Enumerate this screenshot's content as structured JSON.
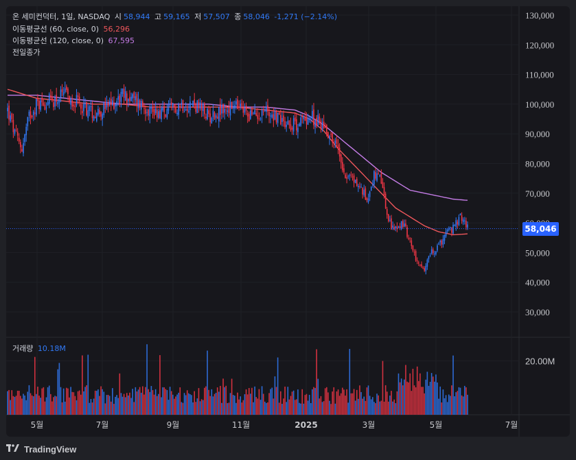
{
  "header": {
    "title": "온 세미컨덕터, 1일, NASDAQ",
    "open_label": "시",
    "open": "58,944",
    "high_label": "고",
    "high": "59,165",
    "low_label": "저",
    "low": "57,507",
    "close_label": "종",
    "close": "58,046",
    "change": "-1,271 (−2.14%)"
  },
  "indicators": {
    "ma60_label": "이동평균선 (60, close, 0)",
    "ma60_value": "56,296",
    "ma120_label": "이동평균선 (120, close, 0)",
    "ma120_value": "67,595",
    "prev_close_label": "전일종가"
  },
  "volume": {
    "label": "거래량",
    "value": "10.18M"
  },
  "price_badge": "58,046",
  "footer": {
    "brand": "TradingView"
  },
  "colors": {
    "up": "#3179f5",
    "down": "#f23645",
    "ma60": "#f0575c",
    "ma120": "#c47ce6",
    "badge": "#2962ff"
  },
  "chart_data": {
    "type": "candlestick",
    "y_axis": {
      "ticks": [
        "130,000",
        "120,000",
        "110,000",
        "100,000",
        "90,000",
        "80,000",
        "70,000",
        "60,000",
        "50,000",
        "40,000",
        "30,000"
      ],
      "tick_values": [
        130000,
        120000,
        110000,
        100000,
        90000,
        80000,
        70000,
        60000,
        50000,
        40000,
        30000
      ]
    },
    "volume_axis": {
      "ticks": [
        "20.00M"
      ],
      "tick_values": [
        20000000
      ]
    },
    "x_axis": {
      "ticks": [
        "5월",
        "7월",
        "9월",
        "11월",
        "2025",
        "3월",
        "5월",
        "7월"
      ]
    },
    "last_price": 58046,
    "ma60_last": 56296,
    "ma120_last": 67595,
    "close_approx": [
      [
        0,
        98000
      ],
      [
        5,
        90000
      ],
      [
        10,
        85000
      ],
      [
        15,
        96000
      ],
      [
        20,
        100000
      ],
      [
        30,
        101000
      ],
      [
        40,
        103000
      ],
      [
        50,
        100000
      ],
      [
        60,
        97000
      ],
      [
        70,
        99000
      ],
      [
        80,
        103000
      ],
      [
        90,
        101000
      ],
      [
        100,
        98000
      ],
      [
        110,
        97000
      ],
      [
        120,
        100000
      ],
      [
        130,
        100000
      ],
      [
        140,
        96000
      ],
      [
        150,
        98000
      ],
      [
        160,
        99000
      ],
      [
        170,
        96000
      ],
      [
        180,
        98000
      ],
      [
        190,
        95000
      ],
      [
        200,
        93000
      ],
      [
        210,
        96000
      ],
      [
        220,
        93000
      ],
      [
        225,
        89000
      ],
      [
        230,
        85000
      ],
      [
        235,
        76000
      ],
      [
        240,
        75000
      ],
      [
        245,
        72000
      ],
      [
        250,
        68000
      ],
      [
        255,
        76000
      ],
      [
        260,
        74000
      ],
      [
        265,
        60000
      ],
      [
        270,
        58000
      ],
      [
        275,
        60000
      ],
      [
        280,
        54000
      ],
      [
        285,
        47000
      ],
      [
        290,
        45000
      ],
      [
        295,
        50000
      ],
      [
        300,
        52000
      ],
      [
        305,
        57000
      ],
      [
        310,
        58000
      ],
      [
        315,
        62000
      ],
      [
        320,
        59000
      ]
    ],
    "ma60_approx": [
      [
        0,
        105000
      ],
      [
        20,
        102000
      ],
      [
        40,
        101000
      ],
      [
        60,
        100000
      ],
      [
        80,
        100000
      ],
      [
        100,
        99000
      ],
      [
        120,
        99000
      ],
      [
        140,
        99000
      ],
      [
        160,
        99000
      ],
      [
        180,
        98000
      ],
      [
        200,
        97000
      ],
      [
        210,
        95000
      ],
      [
        220,
        91000
      ],
      [
        230,
        85000
      ],
      [
        240,
        80000
      ],
      [
        250,
        75000
      ],
      [
        260,
        70000
      ],
      [
        270,
        65000
      ],
      [
        280,
        62000
      ],
      [
        290,
        59000
      ],
      [
        300,
        57000
      ],
      [
        310,
        56000
      ],
      [
        320,
        56296
      ]
    ],
    "ma120_approx": [
      [
        0,
        103000
      ],
      [
        20,
        103000
      ],
      [
        40,
        102000
      ],
      [
        60,
        101000
      ],
      [
        80,
        100000
      ],
      [
        100,
        100000
      ],
      [
        120,
        100000
      ],
      [
        140,
        100000
      ],
      [
        160,
        99000
      ],
      [
        180,
        99000
      ],
      [
        200,
        98000
      ],
      [
        210,
        96000
      ],
      [
        220,
        93000
      ],
      [
        230,
        89000
      ],
      [
        240,
        85000
      ],
      [
        250,
        81000
      ],
      [
        260,
        77000
      ],
      [
        270,
        74000
      ],
      [
        280,
        71000
      ],
      [
        290,
        70000
      ],
      [
        300,
        69000
      ],
      [
        310,
        68000
      ],
      [
        320,
        67595
      ]
    ],
    "volume_range_millions": [
      3,
      28
    ]
  }
}
